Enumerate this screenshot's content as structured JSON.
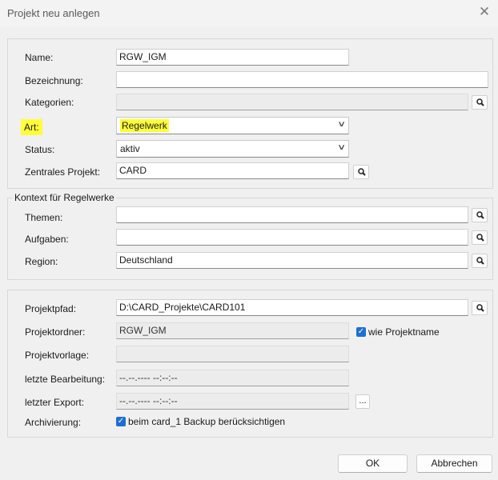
{
  "window": {
    "title": "Projekt neu anlegen"
  },
  "general": {
    "name_label": "Name:",
    "name_value": "RGW_IGM",
    "bezeichnung_label": "Bezeichnung:",
    "bezeichnung_value": "",
    "kategorien_label": "Kategorien:",
    "kategorien_value": "",
    "art_label": "Art:",
    "art_value": "Regelwerk",
    "status_label": "Status:",
    "status_value": "aktiv",
    "zentral_label": "Zentrales Projekt:",
    "zentral_value": "CARD"
  },
  "kontext": {
    "title": "Kontext für Regelwerke",
    "themen_label": "Themen:",
    "themen_value": "",
    "aufgaben_label": "Aufgaben:",
    "aufgaben_value": "",
    "region_label": "Region:",
    "region_value": "Deutschland"
  },
  "project": {
    "pfad_label": "Projektpfad:",
    "pfad_value": "D:\\CARD_Projekte\\CARD101",
    "ordner_label": "Projektordner:",
    "ordner_value": "RGW_IGM",
    "wie_label": "wie Projektname",
    "vorlage_label": "Projektvorlage:",
    "vorlage_value": "",
    "bearbeitung_label": "letzte Bearbeitung:",
    "bearbeitung_value": "--.--.---- --:--:--",
    "export_label": "letzter Export:",
    "export_value": "--.--.---- --:--:--",
    "dots_label": "...",
    "archiv_label": "Archivierung:",
    "archiv_check_label": "beim card_1 Backup berücksichtigen"
  },
  "footer": {
    "ok_label": "OK",
    "cancel_label": "Abbrechen"
  },
  "colors": {
    "highlight": "#ffff3b",
    "checkbox": "#1f6fd1"
  }
}
